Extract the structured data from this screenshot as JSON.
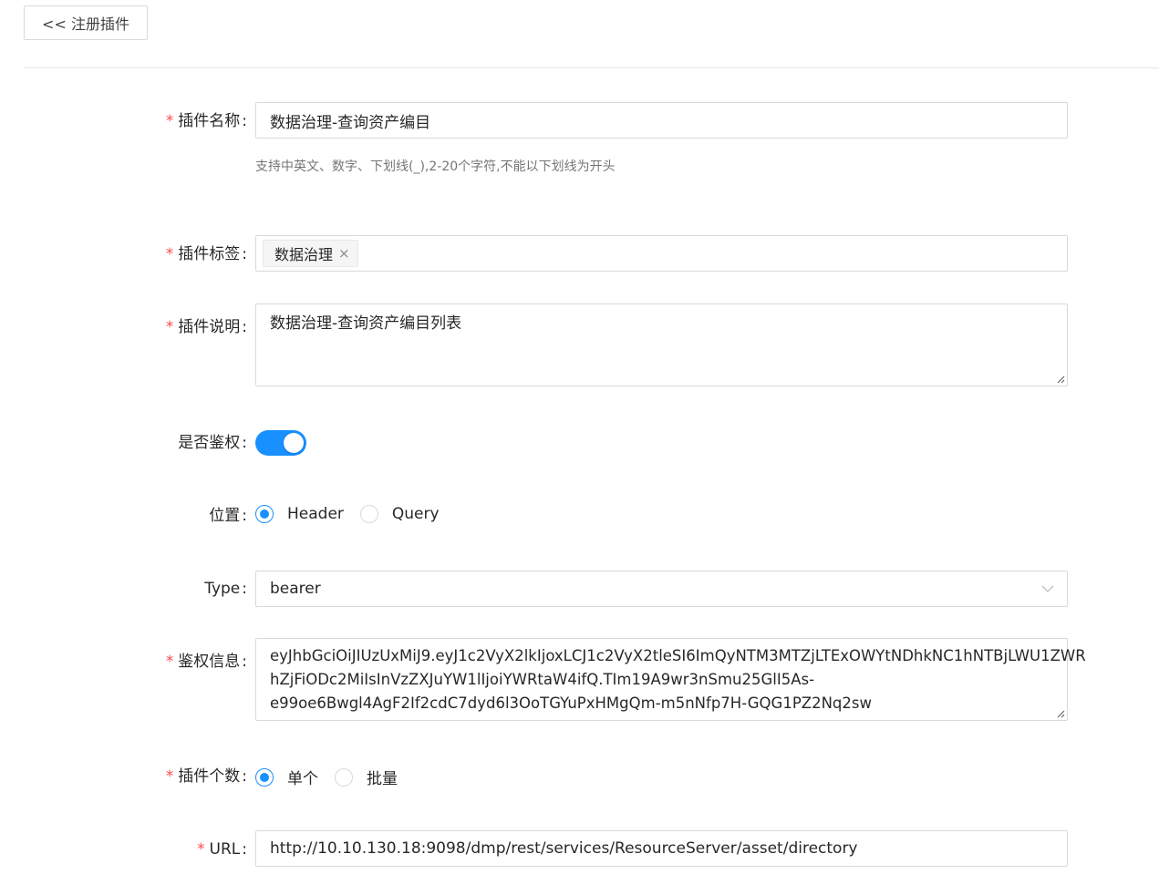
{
  "header": {
    "back_label": "<< 注册插件"
  },
  "form": {
    "name": {
      "label": "插件名称",
      "value": "数据治理-查询资产编目",
      "hint": "支持中英文、数字、下划线(_),2-20个字符,不能以下划线为开头"
    },
    "tags": {
      "label": "插件标签",
      "items": [
        "数据治理"
      ]
    },
    "desc": {
      "label": "插件说明",
      "value": "数据治理-查询资产编目列表"
    },
    "auth": {
      "label": "是否鉴权",
      "enabled": true
    },
    "position": {
      "label": "位置",
      "options": [
        "Header",
        "Query"
      ],
      "selected": "Header"
    },
    "type": {
      "label": "Type",
      "value": "bearer"
    },
    "auth_info": {
      "label": "鉴权信息",
      "lines": [
        "eyJhbGciOiJIUzUxMiJ9.eyJ1c2VyX2lkIjoxLCJ1c2VyX2tleSI6ImQyNTM3MTZjLTExOWYtNDhkNC1hNTBjLWU1ZWR",
        "hZjFiODc2MiIsInVzZXJuYW1lIjoiYWRtaW4ifQ.TIm19A9wr3nSmu25GlI5As-",
        "e99oe6Bwgl4AgF2If2cdC7dyd6l3OoTGYuPxHMgQm-m5nNfp7H-GQG1PZ2Nq2sw"
      ]
    },
    "count": {
      "label": "插件个数",
      "options": [
        "单个",
        "批量"
      ],
      "selected": "单个"
    },
    "url": {
      "label": "URL",
      "value": "http://10.10.130.18:9098/dmp/rest/services/ResourceServer/asset/directory"
    }
  },
  "colors": {
    "primary": "#1890ff",
    "required": "#ff4d4f",
    "border": "#d9d9d9"
  }
}
